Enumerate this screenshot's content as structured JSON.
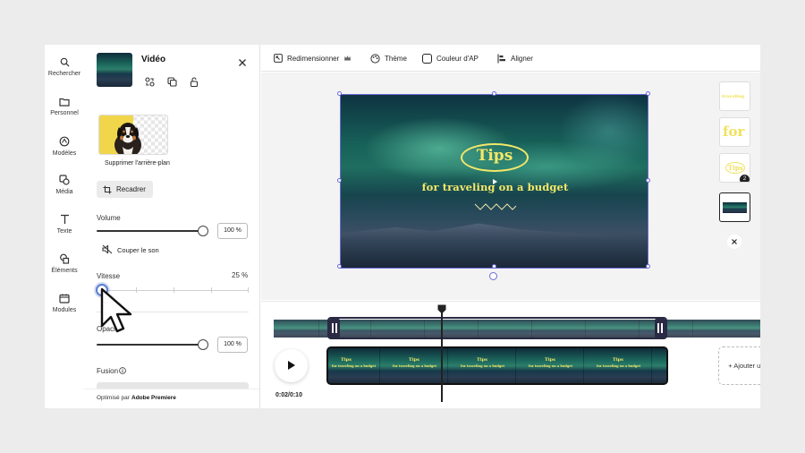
{
  "rail": [
    {
      "label": "Rechercher",
      "icon": "search-icon"
    },
    {
      "label": "Personnel",
      "icon": "folder-icon"
    },
    {
      "label": "Modèles",
      "icon": "templates-icon"
    },
    {
      "label": "Média",
      "icon": "media-icon"
    },
    {
      "label": "Texte",
      "icon": "text-icon"
    },
    {
      "label": "Éléments",
      "icon": "elements-icon"
    },
    {
      "label": "Modules",
      "icon": "modules-icon"
    }
  ],
  "panel": {
    "title": "Vidéo",
    "remove_bg": "Supprimer l'arrière-plan",
    "crop": "Recadrer",
    "volume_label": "Volume",
    "volume_value": "100 %",
    "mute": "Couper le son",
    "speed_label": "Vitesse",
    "speed_value": "25 %",
    "opacity_label": "Opacité",
    "opacity_value": "100 %",
    "blend_label": "Fusion",
    "footer_prefix": "Optimisé par",
    "footer_brand": "Adobe Premiere",
    "volume_level": 1.0,
    "speed_level": 0.0,
    "opacity_level": 1.0
  },
  "toolbar": {
    "resize": "Redimensionner",
    "theme": "Thème",
    "color": "Couleur d'AP",
    "align": "Aligner"
  },
  "canvas": {
    "tips": "Tips",
    "subtitle": "for traveling on a budget"
  },
  "side_thumbs": {
    "t1": "traveling",
    "t2": "for",
    "t3": "Tips",
    "badge": "2"
  },
  "timeline": {
    "time": "0:02/0:10",
    "add_scene": "+ Ajouter une scène"
  },
  "colors": {
    "accent": "#6b6bd6",
    "title_yellow": "#f4e86a"
  }
}
